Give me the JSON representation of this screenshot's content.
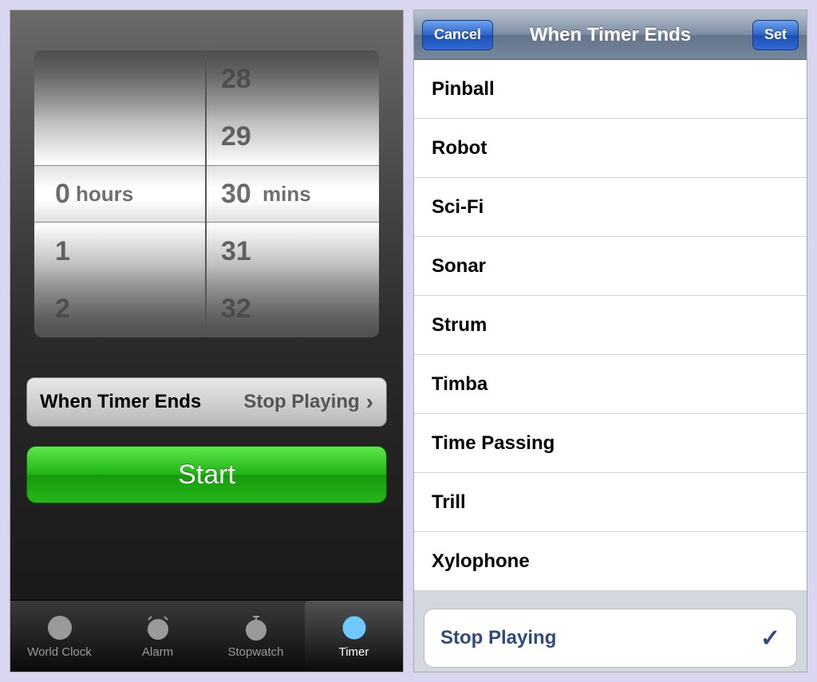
{
  "timer": {
    "picker": {
      "hours_values": [
        "",
        "",
        "0",
        "1",
        "2"
      ],
      "minutes_values": [
        "28",
        "29",
        "30",
        "31",
        "32"
      ],
      "hours_unit": "hours",
      "minutes_unit": "mins"
    },
    "option_row": {
      "label": "When Timer Ends",
      "value": "Stop Playing"
    },
    "start_label": "Start",
    "tabs": [
      {
        "label": "World Clock"
      },
      {
        "label": "Alarm"
      },
      {
        "label": "Stopwatch"
      },
      {
        "label": "Timer"
      }
    ],
    "active_tab_index": 3
  },
  "sound_select": {
    "nav": {
      "cancel": "Cancel",
      "title": "When Timer Ends",
      "set": "Set"
    },
    "sounds": [
      "Pinball",
      "Robot",
      "Sci-Fi",
      "Sonar",
      "Strum",
      "Timba",
      "Time Passing",
      "Trill",
      "Xylophone"
    ],
    "special": {
      "label": "Stop Playing",
      "selected": true
    }
  }
}
